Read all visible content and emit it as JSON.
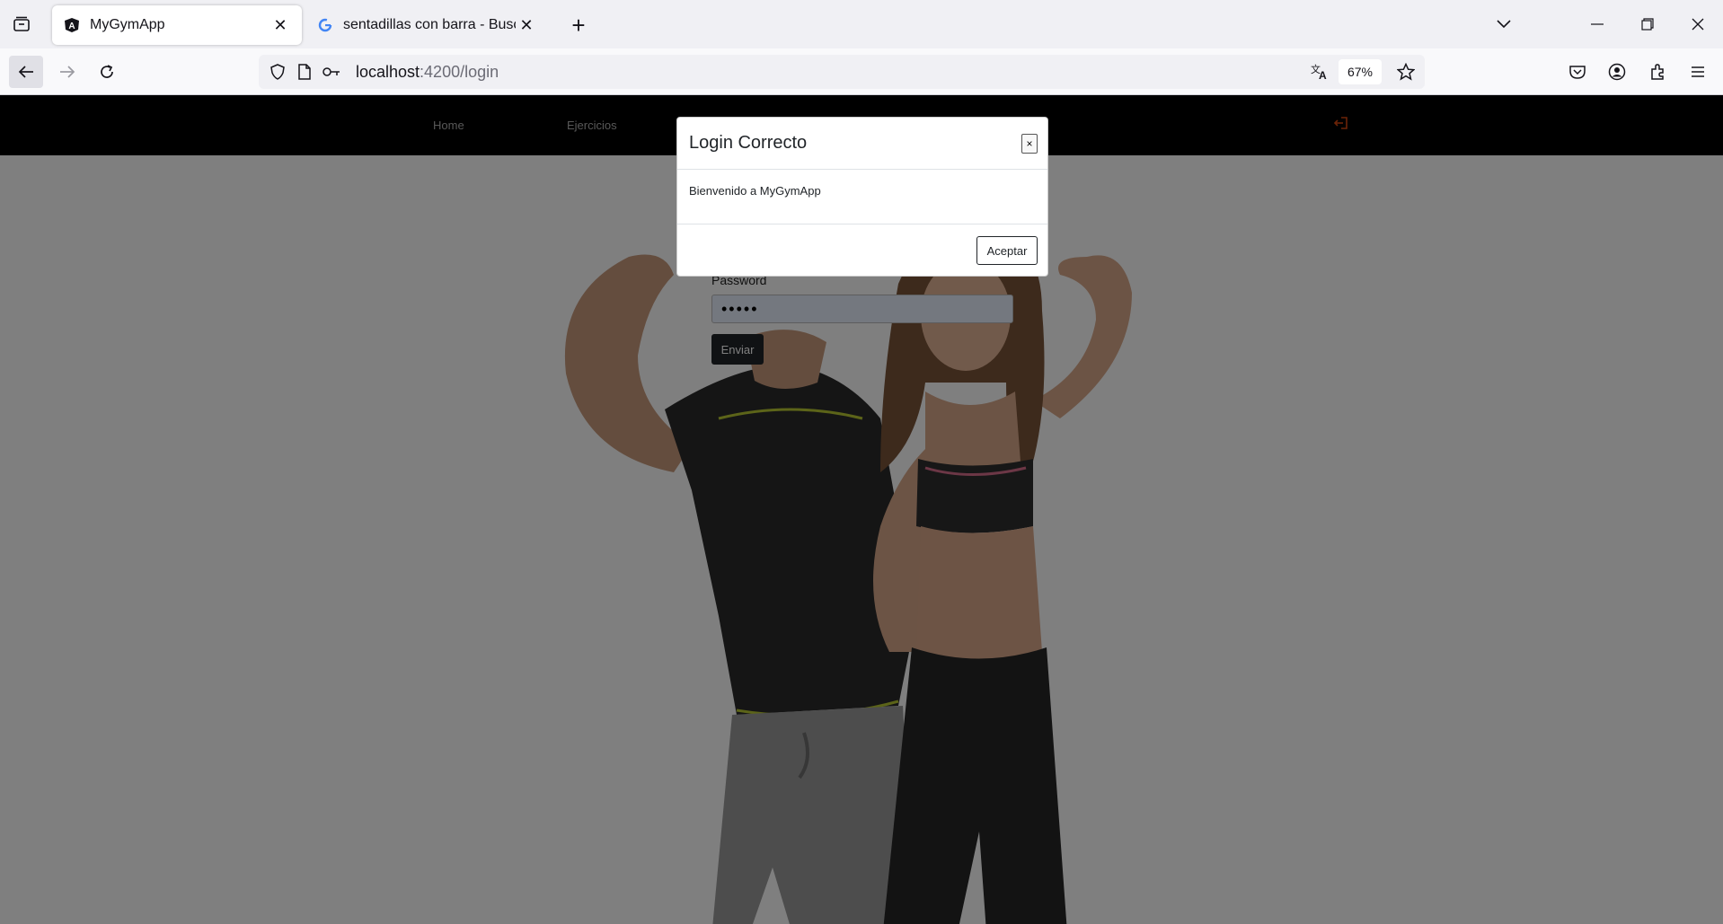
{
  "browser": {
    "tabs": [
      {
        "title": "MyGymApp",
        "favicon": "angular-icon",
        "active": true
      },
      {
        "title": "sentadillas con barra - Buscar con Google",
        "favicon": "google-icon",
        "active": false
      }
    ],
    "url": {
      "host": "localhost",
      "path": ":4200/login"
    },
    "zoom": "67%"
  },
  "site": {
    "nav": {
      "home": "Home",
      "ejercicios": "Ejercicios"
    },
    "form": {
      "password_label": "Password",
      "password_value": "•••••",
      "submit_label": "Enviar"
    }
  },
  "modal": {
    "title": "Login Correcto",
    "close_label": "×",
    "body": "Bienvenido a MyGymApp",
    "accept_label": "Aceptar"
  },
  "colors": {
    "logout_icon": "#d9480f",
    "navbar": "#000000"
  }
}
